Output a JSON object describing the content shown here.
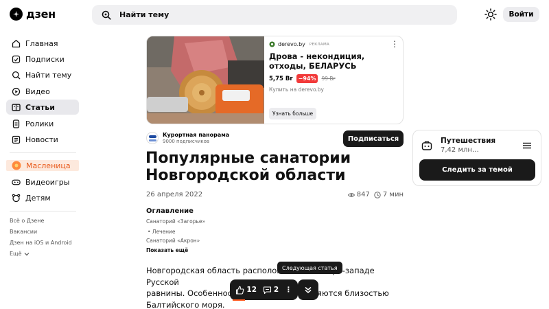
{
  "header": {
    "logo_text": "дзен",
    "search_placeholder": "Найти тему",
    "login_label": "Войти"
  },
  "sidebar": {
    "items": [
      {
        "label": "Главная",
        "icon": "home-icon"
      },
      {
        "label": "Подписки",
        "icon": "subscriptions-icon"
      },
      {
        "label": "Найти тему",
        "icon": "search-topic-icon"
      },
      {
        "label": "Видео",
        "icon": "video-icon"
      },
      {
        "label": "Статьи",
        "icon": "articles-icon",
        "active": true
      },
      {
        "label": "Ролики",
        "icon": "shorts-icon"
      },
      {
        "label": "Новости",
        "icon": "news-icon"
      }
    ],
    "promo_items": [
      {
        "label": "Масленица",
        "icon": "maslenitsa-icon"
      },
      {
        "label": "Видеоигры",
        "icon": "gamepad-icon"
      },
      {
        "label": "Детям",
        "icon": "kids-icon"
      }
    ],
    "footer_links": [
      "Всё о Дзене",
      "Вакансии",
      "Дзен на iOS и Android",
      "Ещё"
    ]
  },
  "ad": {
    "source": "derevo.by",
    "tag": "РЕКЛАМА",
    "title": "Дрова - некондиция, отходы, БЕЛАРУСЬ",
    "price": "5,75 Br",
    "discount": "−94%",
    "old_price": "99 Br",
    "buy_text": "Купить на derevo.by",
    "button_label": "Узнать больше"
  },
  "channel": {
    "name": "Курортная панорама",
    "subscribers": "9000 подписчиков",
    "subscribe_label": "Подписаться"
  },
  "article": {
    "title": "Популярные санатории Новгородской области",
    "date": "26 апреля 2022",
    "views": "847",
    "read_time": "7 мин",
    "toc_title": "Оглавление",
    "toc_items": [
      "Санаторий «Загорье»",
      "• Лечение",
      "Санаторий «Акрон»"
    ],
    "toc_more": "Показать ещё",
    "paragraph_lines": [
      "Новгородская область расположена на северо-западе Русской",
      "равнины. Особенности климата определяются близостью",
      "Балтийского моря."
    ]
  },
  "action_bar": {
    "tooltip": "Следующая статья",
    "likes": "12",
    "comments": "2"
  },
  "widget": {
    "title": "Путешествия",
    "subtitle": "7,42 млн…",
    "follow_label": "Следить за темой"
  },
  "colors": {
    "accent": "#1a1a1a",
    "promo": "#e85a1b",
    "discount": "#f23a3a",
    "progress": "#ff5a1f"
  }
}
